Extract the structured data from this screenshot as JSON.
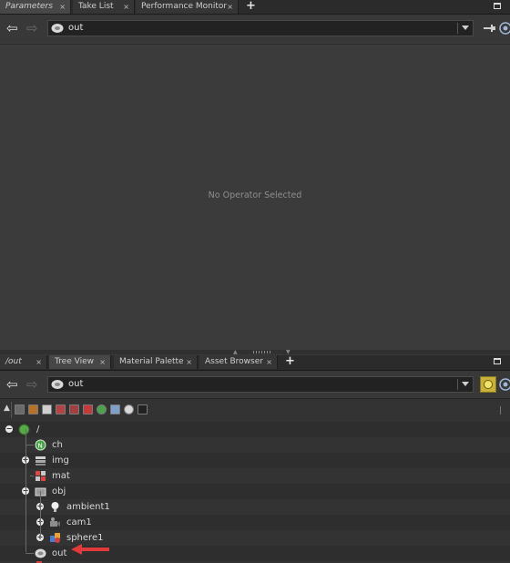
{
  "top_tabs": [
    {
      "label": "Parameters",
      "close": "×"
    },
    {
      "label": "Take List",
      "close": "×"
    },
    {
      "label": "Performance Monitor",
      "close": "×"
    }
  ],
  "bottom_tabs": [
    {
      "label": "/out",
      "close": "×"
    },
    {
      "label": "Tree View",
      "close": "×"
    },
    {
      "label": "Material Palette",
      "close": "×"
    },
    {
      "label": "Asset Browser",
      "close": "×"
    }
  ],
  "plus": "+",
  "top_path": {
    "value": "out"
  },
  "bottom_path": {
    "value": "out"
  },
  "params": {
    "empty_message": "No Operator Selected"
  },
  "tree": {
    "root": "/",
    "items": [
      {
        "label": "ch"
      },
      {
        "label": "img"
      },
      {
        "label": "mat"
      },
      {
        "label": "obj"
      },
      {
        "label": "ambient1"
      },
      {
        "label": "cam1"
      },
      {
        "label": "sphere1"
      },
      {
        "label": "out"
      }
    ]
  },
  "colors": {
    "accent_arrow": "#e03a3a",
    "highlight_button": "#c8b23a"
  },
  "icons": [
    "back-arrow-icon",
    "forward-arrow-icon",
    "network-icon",
    "pin-icon",
    "globe-icon",
    "chevron-down-icon"
  ]
}
